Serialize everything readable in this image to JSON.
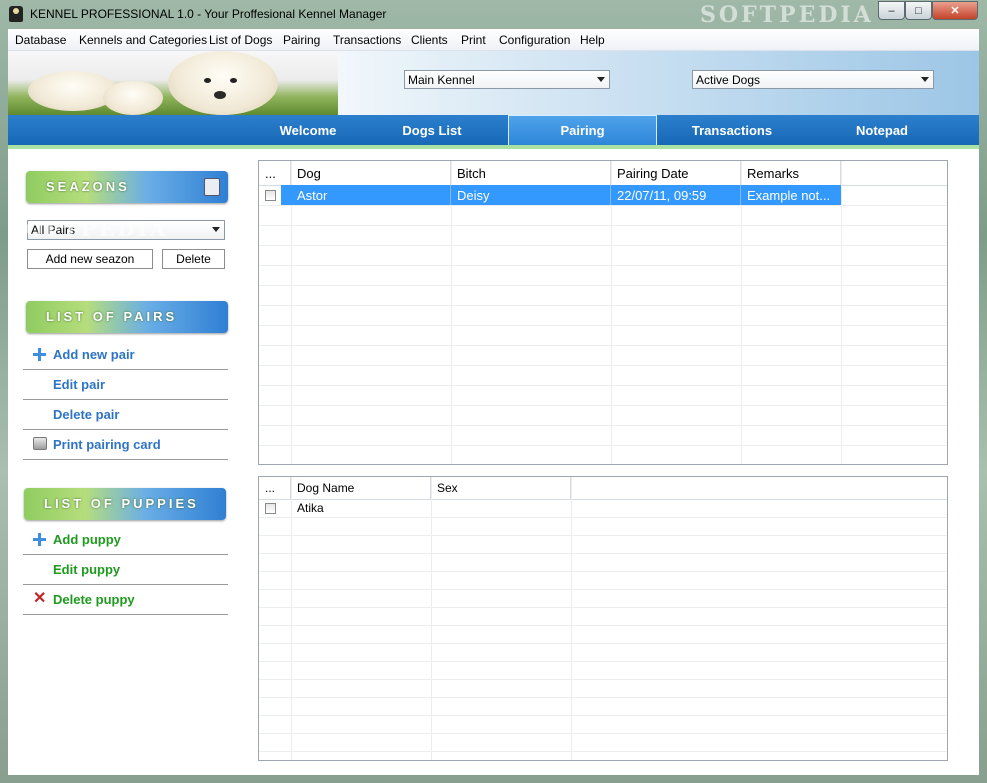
{
  "window": {
    "title": "KENNEL PROFESSIONAL 1.0 - Your Proffesional Kennel Manager",
    "min_glyph": "–",
    "max_glyph": "□",
    "close_glyph": "✕"
  },
  "menu": {
    "items": [
      "Database",
      "Kennels and Categories",
      "List of Dogs",
      "Pairing",
      "Transactions",
      "Clients",
      "Print",
      "Configuration",
      "Help"
    ]
  },
  "banner": {
    "kennel_select": "Main Kennel",
    "dogs_select": "Active Dogs"
  },
  "tabs": {
    "items": [
      {
        "label": "Welcome",
        "active": false
      },
      {
        "label": "Dogs List",
        "active": false
      },
      {
        "label": "Pairing",
        "active": true
      },
      {
        "label": "Transactions",
        "active": false
      },
      {
        "label": "Notepad",
        "active": false
      }
    ]
  },
  "seasons": {
    "title": "SEAZONS",
    "filter": "All Pairs",
    "add_button": "Add new seazon",
    "delete_button": "Delete"
  },
  "pairs": {
    "title": "LIST OF PAIRS",
    "add": "Add new pair",
    "edit": "Edit pair",
    "delete": "Delete pair",
    "print": "Print pairing card"
  },
  "puppies": {
    "title": "LIST OF PUPPIES",
    "add": "Add puppy",
    "edit": "Edit puppy",
    "delete": "Delete puppy"
  },
  "pairs_grid": {
    "headers": [
      "...",
      "Dog",
      "Bitch",
      "Pairing Date",
      "Remarks"
    ],
    "rows": [
      {
        "checked": false,
        "dog": "Astor",
        "bitch": "Deisy",
        "date": "22/07/11, 09:59",
        "remarks": "Example not..."
      }
    ]
  },
  "puppies_grid": {
    "headers": [
      "...",
      "Dog Name",
      "Sex"
    ],
    "rows": [
      {
        "checked": false,
        "name": "Atika",
        "sex": ""
      }
    ]
  },
  "colors": {
    "tab_bar": "#1f73c2",
    "selected_row": "#3399ff",
    "link_blue": "#2f74c4",
    "link_green": "#1f9a1f"
  }
}
